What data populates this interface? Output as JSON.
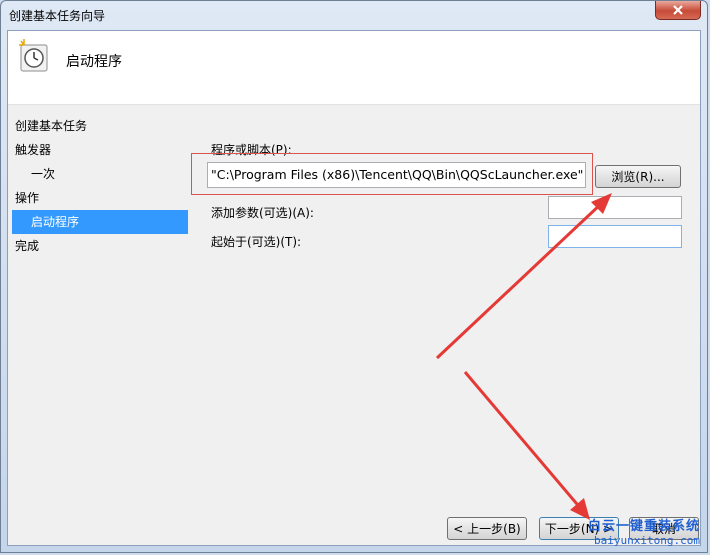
{
  "window": {
    "title": "创建基本任务向导",
    "close_icon": "close-icon"
  },
  "header": {
    "title": "启动程序",
    "icon": "clock-icon"
  },
  "nav": {
    "items": [
      {
        "label": "创建基本任务",
        "indent": false,
        "selected": false
      },
      {
        "label": "触发器",
        "indent": false,
        "selected": false
      },
      {
        "label": "一次",
        "indent": true,
        "selected": false
      },
      {
        "label": "操作",
        "indent": false,
        "selected": false
      },
      {
        "label": "启动程序",
        "indent": true,
        "selected": true
      },
      {
        "label": "完成",
        "indent": false,
        "selected": false
      }
    ]
  },
  "form": {
    "program_label": "程序或脚本(P):",
    "program_value": "\"C:\\Program Files (x86)\\Tencent\\QQ\\Bin\\QQScLauncher.exe\"",
    "browse_label": "浏览(R)...",
    "args_label": "添加参数(可选)(A):",
    "args_value": "",
    "start_in_label": "起始于(可选)(T):",
    "start_in_value": ""
  },
  "footer": {
    "back_label": "< 上一步(B)",
    "next_label": "下一步(N) >",
    "cancel_label": "取消"
  },
  "watermark": {
    "main": "白云一键重装系统",
    "sub": "baiyunxitong.com"
  },
  "colors": {
    "selection": "#3399ff",
    "annotation": "#e53935"
  }
}
